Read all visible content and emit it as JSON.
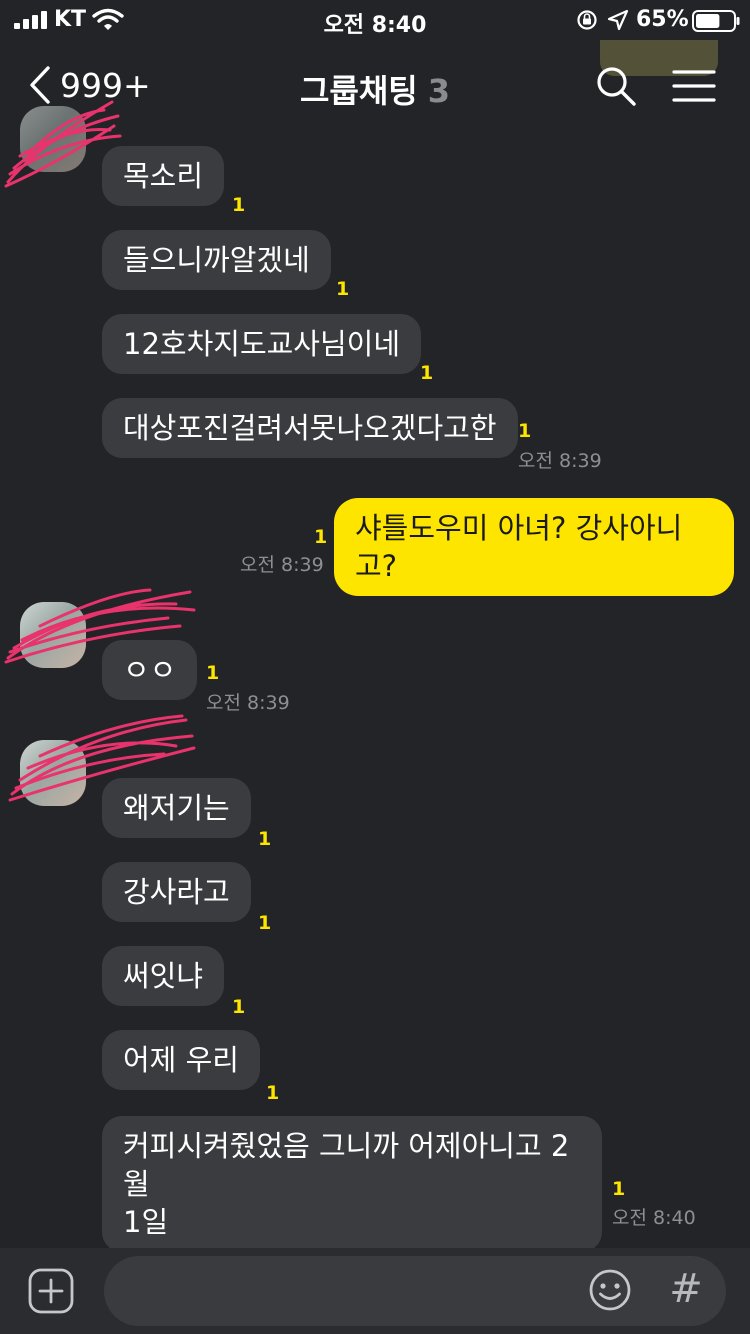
{
  "status_bar": {
    "carrier": "KT",
    "time": "오전 8:40",
    "battery_percent": "65%",
    "battery_level": 0.65,
    "icons": [
      "signal-icon",
      "wifi-icon",
      "orientation-lock-icon",
      "location-icon",
      "battery-icon"
    ]
  },
  "nav": {
    "back_count": "999+",
    "title": "그룹채팅",
    "member_count": "3",
    "icons": [
      "back-chevron-icon",
      "search-icon",
      "menu-icon"
    ]
  },
  "messages": [
    {
      "id": "m1",
      "from": "other",
      "text": "목소리",
      "read": "1",
      "time": ""
    },
    {
      "id": "m2",
      "from": "other",
      "text": "들으니까알겠네",
      "read": "1",
      "time": ""
    },
    {
      "id": "m3",
      "from": "other",
      "text": "12호차지도교사님이네",
      "read": "1",
      "time": ""
    },
    {
      "id": "m4",
      "from": "other",
      "text": "대상포진걸려서못나오겠다고한",
      "read": "1",
      "time": "오전 8:39"
    },
    {
      "id": "m5",
      "from": "me",
      "text": "샤틀도우미 아녀? 강사아니고?",
      "read": "1",
      "time": "오전 8:39"
    },
    {
      "id": "m6",
      "from": "other",
      "text": "ㅇㅇ",
      "read": "1",
      "time": "오전 8:39"
    },
    {
      "id": "m7",
      "from": "other",
      "text": "왜저기는",
      "read": "1",
      "time": ""
    },
    {
      "id": "m8",
      "from": "other",
      "text": "강사라고",
      "read": "1",
      "time": ""
    },
    {
      "id": "m9",
      "from": "other",
      "text": "써잇냐",
      "read": "1",
      "time": ""
    },
    {
      "id": "m10",
      "from": "other",
      "text": "어제 우리",
      "read": "1",
      "time": ""
    },
    {
      "id": "m11",
      "from": "other",
      "text": "커피시켜줬었음 그니까 어제아니고 2월\n1일",
      "read": "1",
      "time": "오전 8:40"
    }
  ],
  "input": {
    "value": "",
    "placeholder": "",
    "icons": [
      "add-icon",
      "emoji-icon",
      "hashtag-icon"
    ],
    "hash_label": "#"
  },
  "colors": {
    "background": "#232427",
    "other_bubble": "#3b3c40",
    "my_bubble": "#fee500",
    "read_count": "#fee500",
    "timestamp": "#8e8f93"
  }
}
